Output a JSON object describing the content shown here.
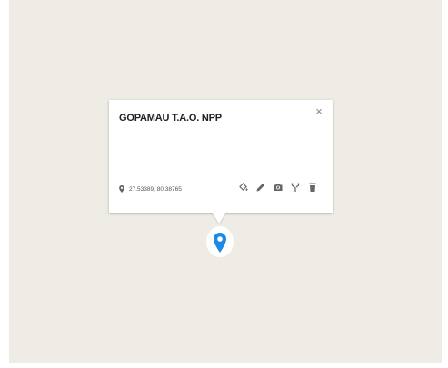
{
  "popup": {
    "title": "GOPAMAU T.A.O. NPP",
    "close_label": "×",
    "coordinates": "27.53389, 80.38765"
  },
  "toolbar": {
    "icons": [
      "paint-bucket-icon",
      "pencil-icon",
      "camera-icon",
      "routing-icon",
      "trash-icon"
    ]
  },
  "marker": {
    "color": "#1e88e5",
    "icon": "map-pin-icon"
  },
  "colors": {
    "map_background": "#efece6",
    "icon_color": "#666666"
  }
}
